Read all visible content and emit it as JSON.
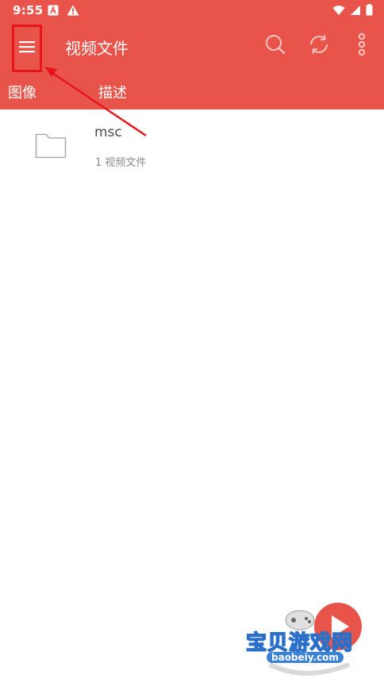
{
  "status_bar": {
    "time": "9:55",
    "left_icons": [
      "app-a-icon",
      "warning-icon"
    ],
    "right_icons": [
      "wifi-icon",
      "signal-icon",
      "battery-icon"
    ]
  },
  "app_bar": {
    "menu_icon": "hamburger-menu-icon",
    "title": "视频文件",
    "actions": [
      "search-icon",
      "refresh-icon",
      "more-vert-icon"
    ]
  },
  "tabs": [
    {
      "label": "图像"
    },
    {
      "label": "描述"
    }
  ],
  "folders": [
    {
      "name": "msc",
      "subtitle": "1 视频文件",
      "icon": "folder-icon"
    }
  ],
  "watermark": {
    "text": "宝贝游戏网",
    "domain": "baobeiy.com"
  },
  "colors": {
    "primary": "#e8544a",
    "annotation": "#e8141c",
    "text_primary": "#4a4a4a",
    "text_secondary": "#8a8a8a"
  }
}
